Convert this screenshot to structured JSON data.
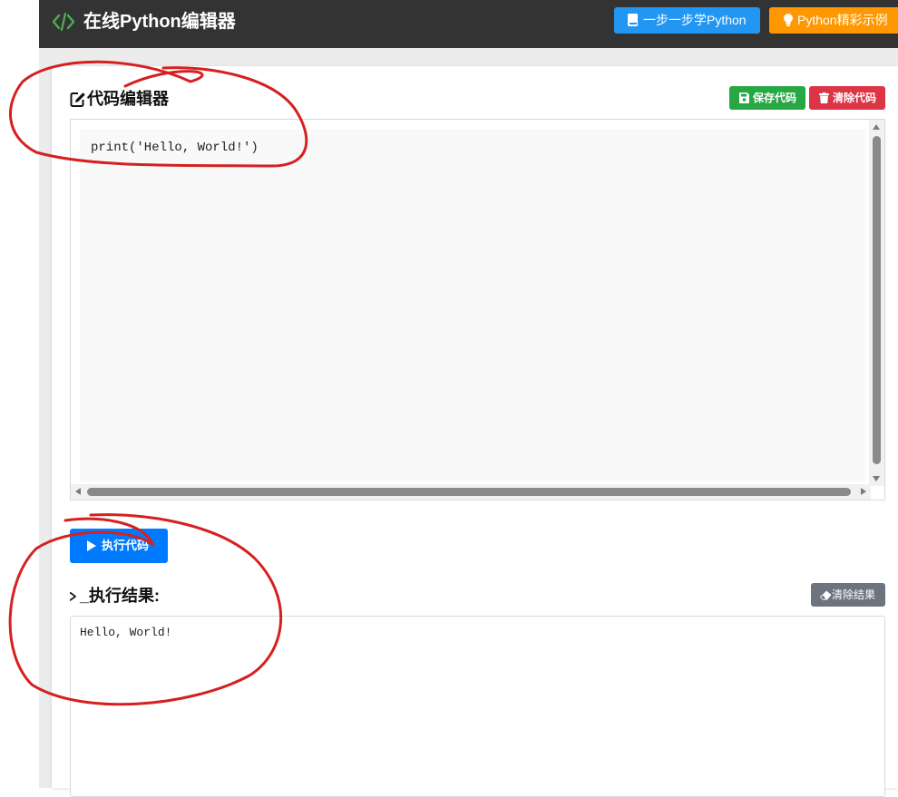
{
  "header": {
    "title": "在线Python编辑器",
    "logo_icon": "code-icon",
    "learn_button": "一步一步学Python",
    "examples_button": "Python精彩示例"
  },
  "editor_section": {
    "title": "代码编辑器",
    "title_icon": "edit-icon",
    "save_button": "保存代码",
    "clear_button": "清除代码",
    "code": "print('Hello, World!')"
  },
  "run_button": "执行代码",
  "result_section": {
    "title": "_执行结果:",
    "title_icon": "terminal-icon",
    "clear_button": "清除结果",
    "output": "Hello, World!"
  },
  "colors": {
    "header_bg": "#333333",
    "learn": "#2196f3",
    "examples": "#ff9800",
    "save": "#28a745",
    "clear": "#dc3545",
    "run": "#007bff",
    "clear_result": "#6c757d",
    "annotation": "#d62020"
  }
}
